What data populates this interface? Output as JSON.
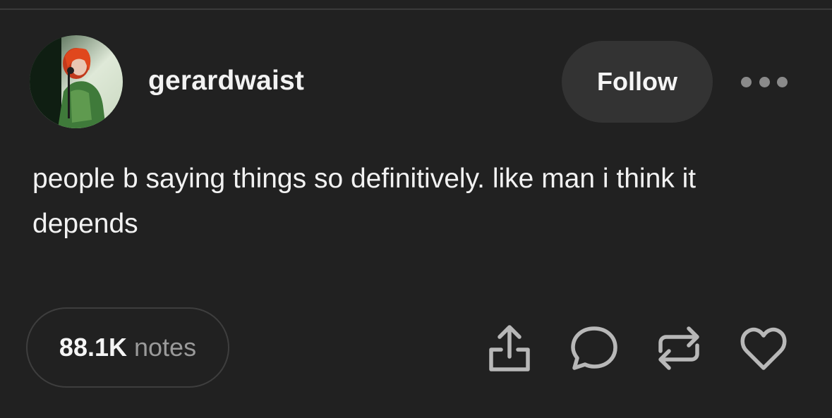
{
  "post": {
    "username": "gerardwaist",
    "follow_label": "Follow",
    "body": "people b saying things so definitively. like man i think it depends",
    "notes_count": "88.1K",
    "notes_label": "notes"
  },
  "icons": {
    "more": "more-horizontal-icon",
    "share": "share-icon",
    "reply": "reply-bubble-icon",
    "reblog": "reblog-icon",
    "like": "heart-icon"
  },
  "colors": {
    "background": "#212121",
    "text": "#f2f2f2",
    "muted": "#9a9a9a",
    "button_bg": "#333333",
    "icon": "#b8b8b8"
  }
}
